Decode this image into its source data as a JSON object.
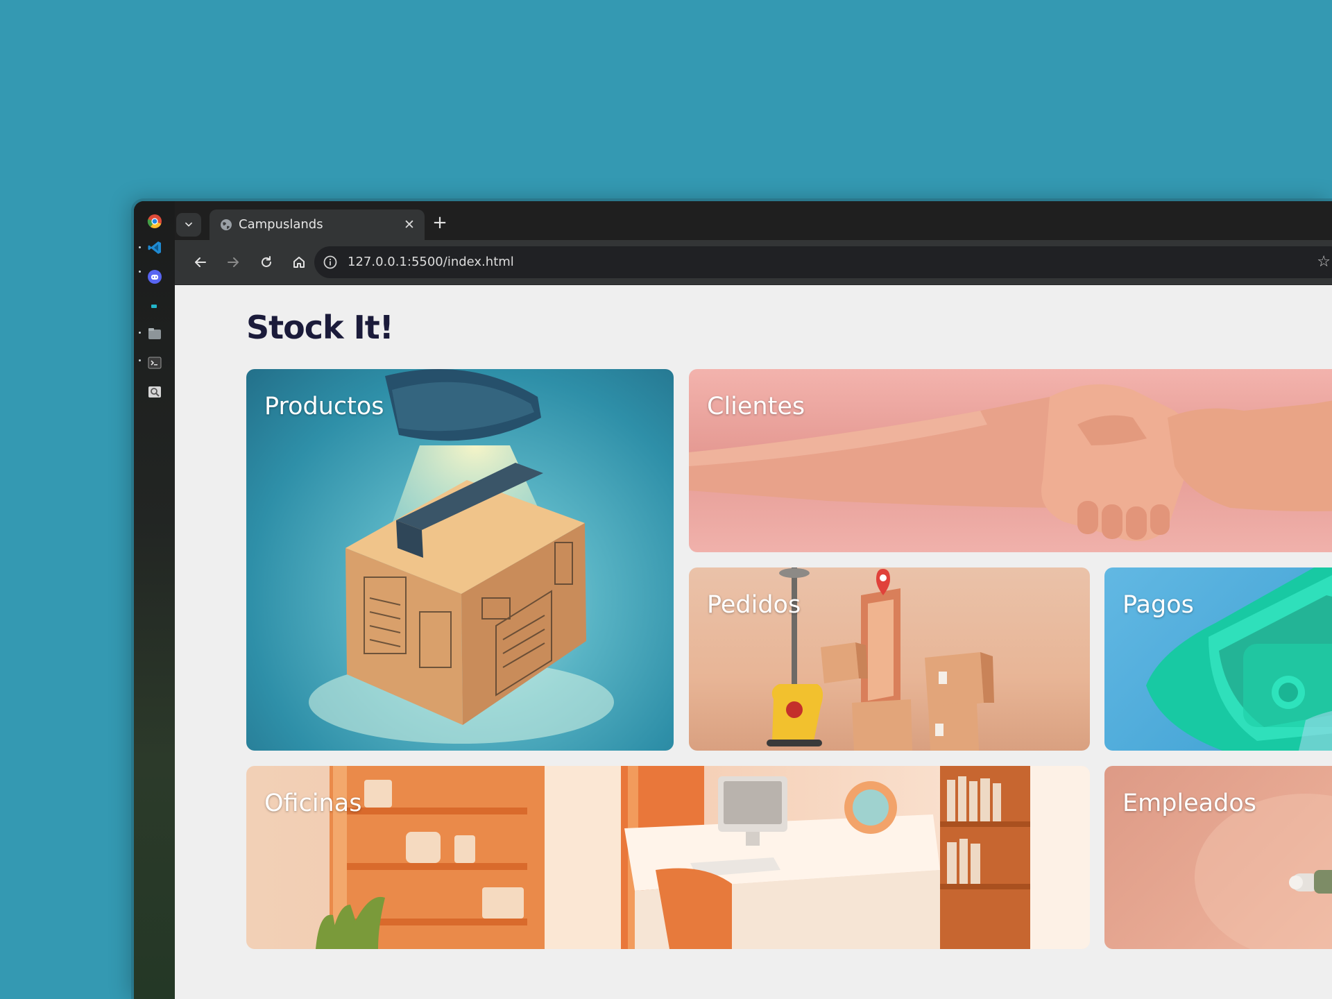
{
  "browser": {
    "tab": {
      "title": "Campuslands",
      "close_glyph": "✕",
      "favicon": "globe-icon"
    },
    "new_tab_glyph": "+",
    "address": {
      "url": "127.0.0.1:5500/index.html",
      "info_icon": "info-icon",
      "bookmark_glyph": "☆"
    },
    "nav_icons": [
      "back-icon",
      "forward-icon",
      "reload-icon",
      "home-icon"
    ]
  },
  "dock": {
    "icons": [
      "chrome-icon",
      "vscode-icon",
      "discord-icon",
      "app-icon",
      "files-icon",
      "terminal-icon",
      "image-viewer-icon"
    ]
  },
  "page": {
    "title": "Stock It!",
    "cards": {
      "productos": "Productos",
      "clientes": "Clientes",
      "pedidos": "Pedidos",
      "pagos": "Pagos",
      "oficinas": "Oficinas",
      "empleados": "Empleados"
    }
  },
  "colors": {
    "desktop_background": "#3499b2",
    "browser_frame": "#1f1f1f",
    "toolbar": "#333536",
    "page_background": "#efefef",
    "title_text": "#1b1b3a"
  }
}
